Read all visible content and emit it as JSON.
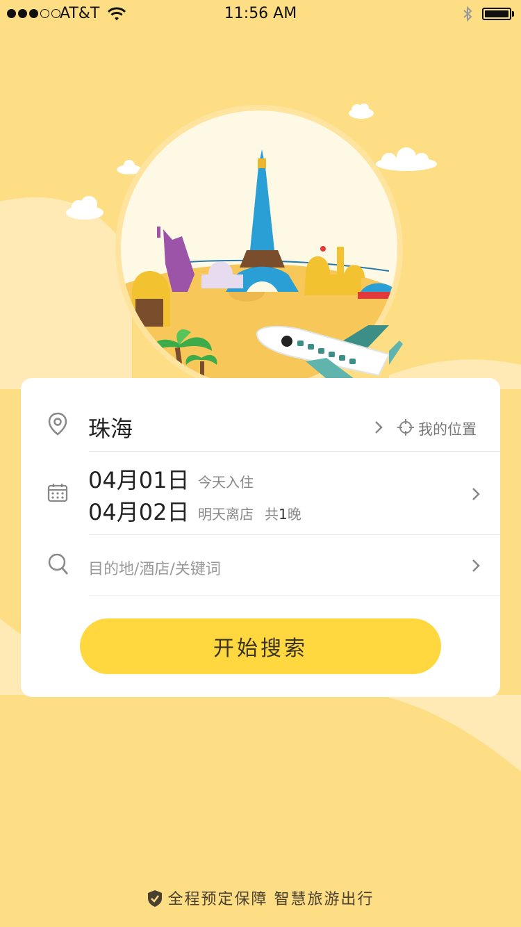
{
  "status_bar": {
    "carrier": "AT&T",
    "time": "11:56 AM",
    "signal_icon": "signal-dots-icon",
    "wifi_icon": "wifi-icon",
    "bluetooth_icon": "bluetooth-icon",
    "battery_icon": "battery-icon"
  },
  "colors": {
    "background": "#FEDE85",
    "wave": "#FFE9B4",
    "button": "#FFD83F",
    "card": "#FFFFFF"
  },
  "location": {
    "icon": "location-pin-icon",
    "city": "珠海",
    "my_location_icon": "crosshair-icon",
    "my_location_label": "我的位置"
  },
  "dates": {
    "icon": "calendar-icon",
    "checkin_date": "04月01日",
    "checkin_note": "今天入住",
    "checkout_date": "04月02日",
    "checkout_note": "明天离店",
    "nights_prefix": "共",
    "nights_count": "1",
    "nights_suffix": "晚"
  },
  "search": {
    "icon": "search-icon",
    "placeholder": "目的地/酒店/关键词",
    "button_label": "开始搜索"
  },
  "footer": {
    "icon": "shield-check-icon",
    "text": "全程预定保障 智慧旅游出行"
  }
}
